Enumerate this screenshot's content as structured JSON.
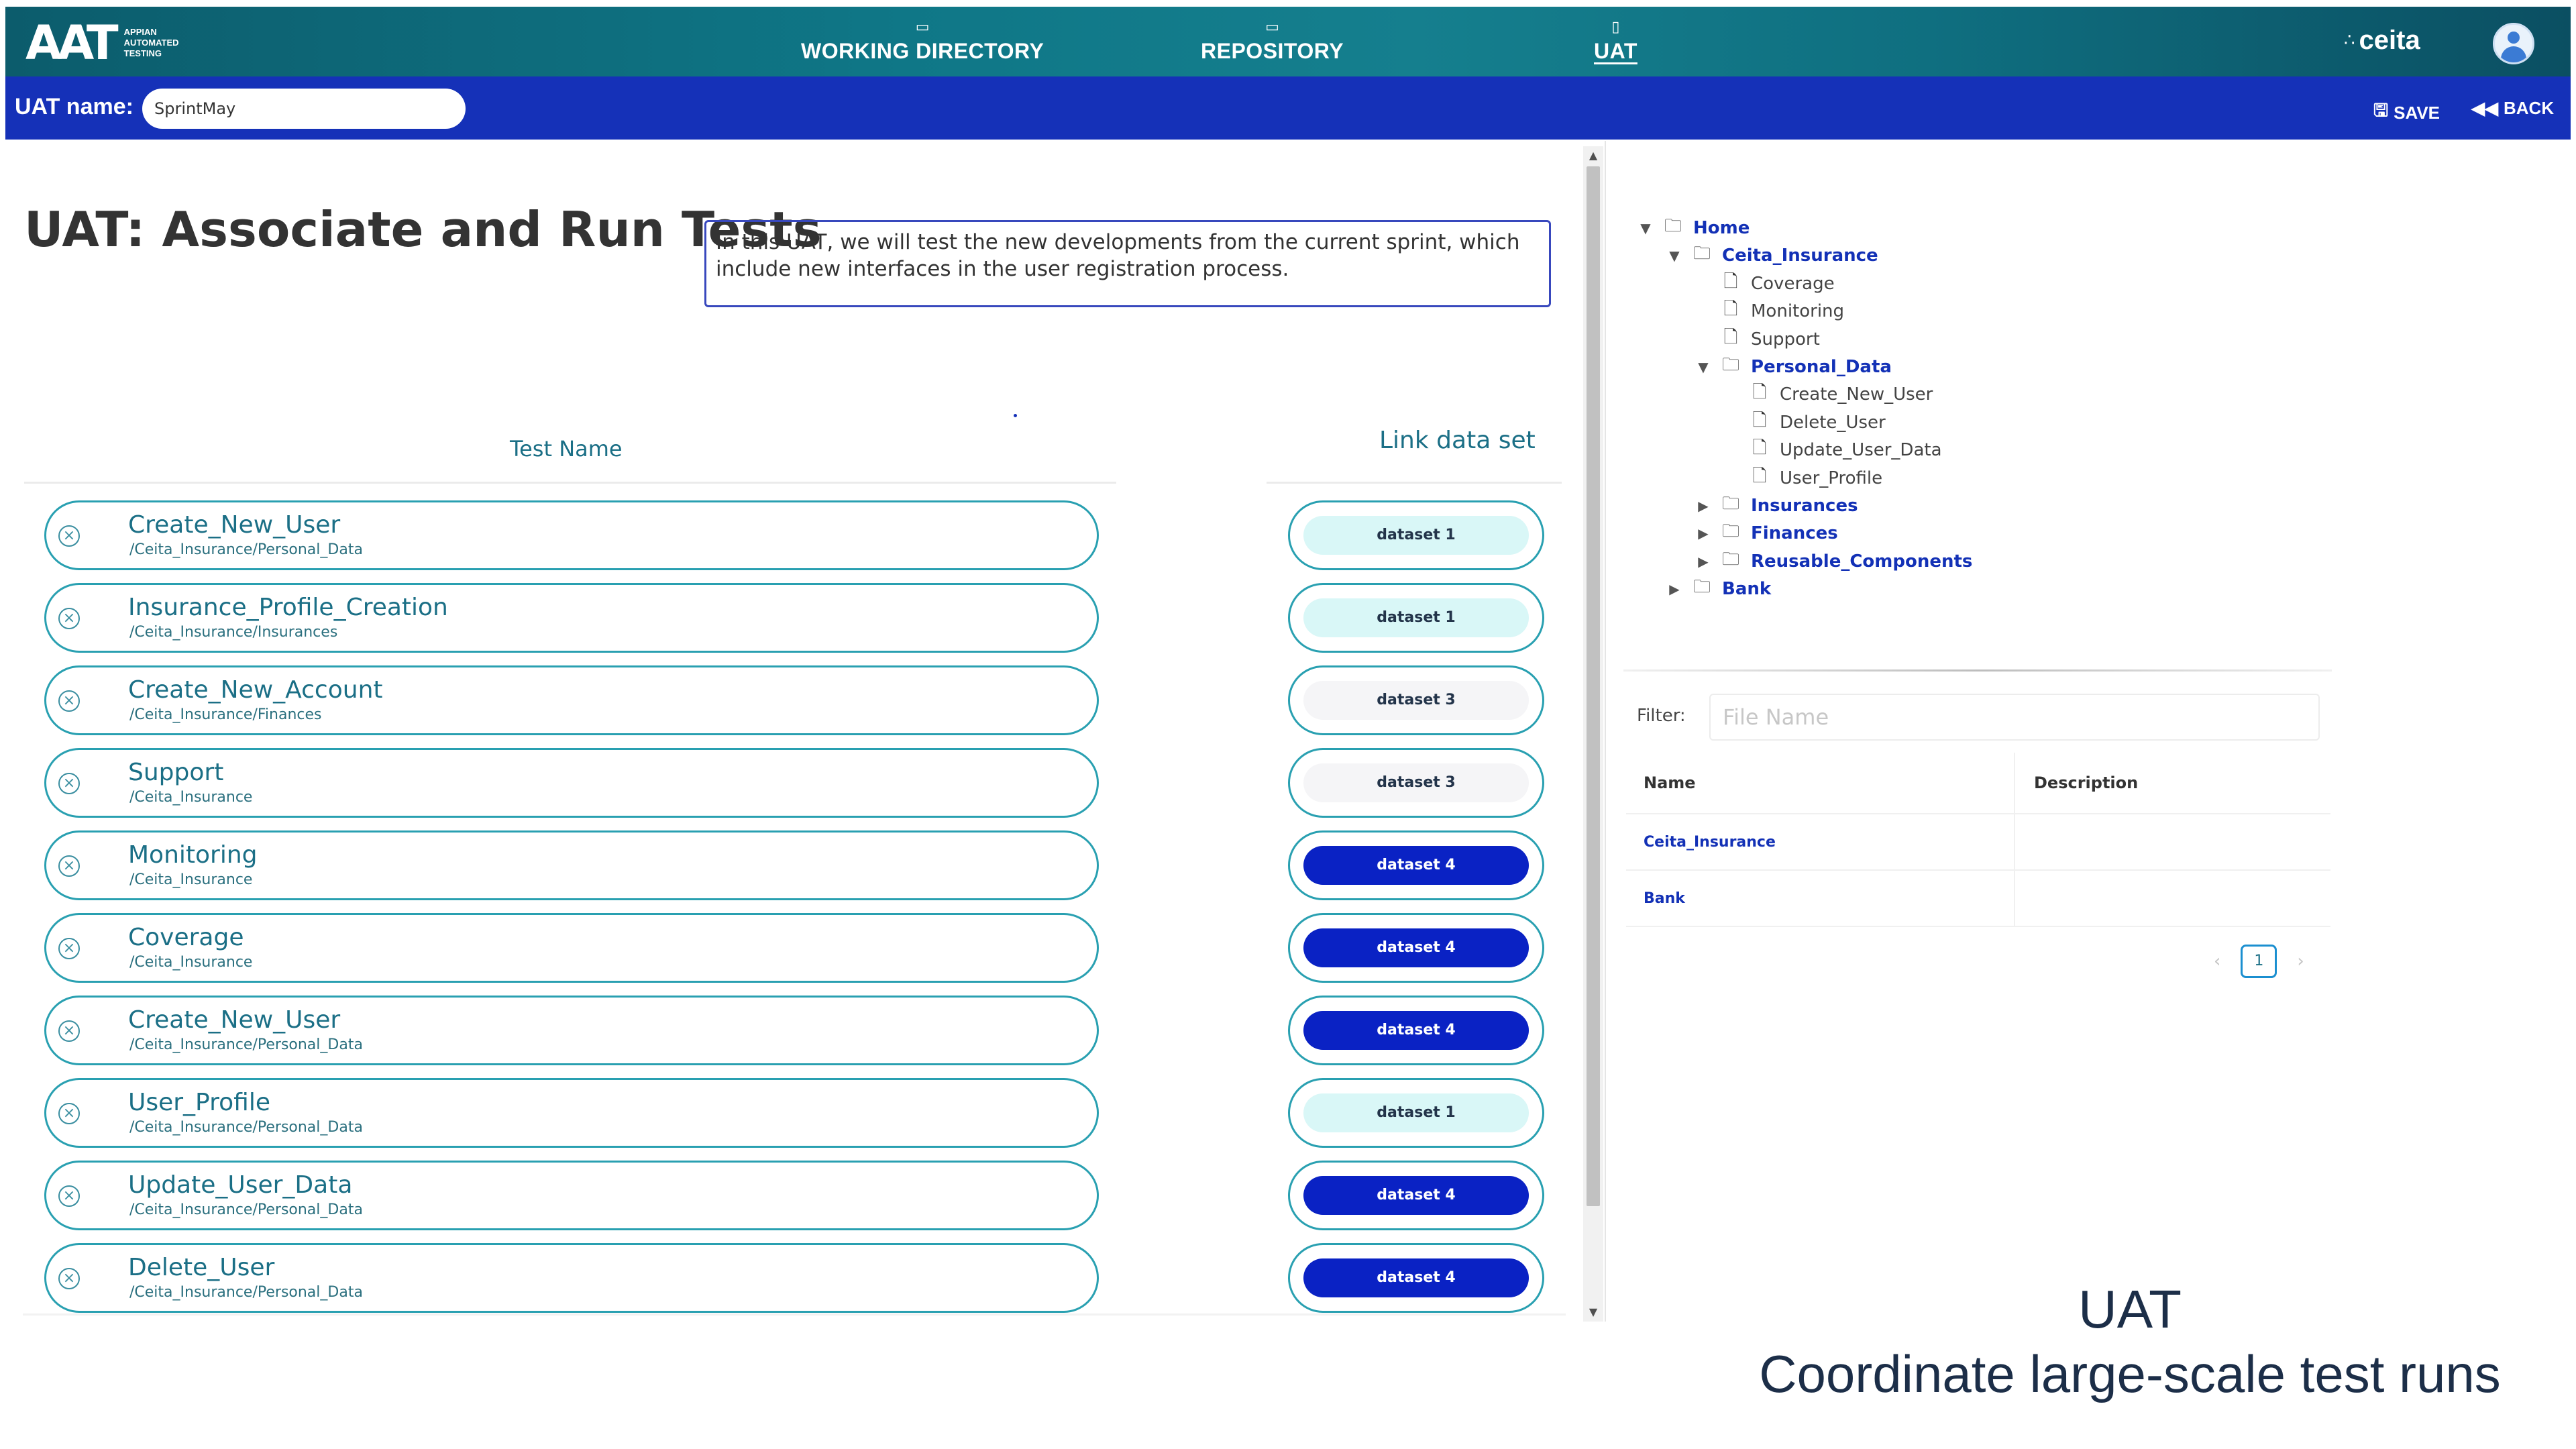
{
  "app": {
    "logo_text": "AAT",
    "logo_sub": [
      "APPIAN",
      "AUTOMATED",
      "TESTING"
    ],
    "brand": "ceita",
    "nav": [
      {
        "label": "WORKING DIRECTORY",
        "icon": "folder-icon"
      },
      {
        "label": "REPOSITORY",
        "icon": "archive-icon"
      },
      {
        "label": "UAT",
        "icon": "document-icon",
        "active": true
      }
    ],
    "accent_color": "#1531b8",
    "header_gradient": "#0f7787"
  },
  "uat_bar": {
    "name_label": "UAT name:",
    "name_value": "SprintMay",
    "save_label": "SAVE",
    "back_label": "BACK"
  },
  "main": {
    "title": "UAT: Associate and Run Tests",
    "description": "In this UAT, we will test the new developments from the current sprint, which include new interfaces in the user registration process.",
    "col_test_name": "Test Name",
    "col_link_dataset": "Link data set",
    "tests": [
      {
        "name": "Create_New_User",
        "path": "/Ceita_Insurance/Personal_Data",
        "dataset": "dataset 1",
        "style": "light"
      },
      {
        "name": "Insurance_Profile_Creation",
        "path": "/Ceita_Insurance/Insurances",
        "dataset": "dataset 1",
        "style": "light"
      },
      {
        "name": "Create_New_Account",
        "path": "/Ceita_Insurance/Finances",
        "dataset": "dataset 3",
        "style": "gray"
      },
      {
        "name": "Support",
        "path": "/Ceita_Insurance",
        "dataset": "dataset 3",
        "style": "gray"
      },
      {
        "name": "Monitoring",
        "path": "/Ceita_Insurance",
        "dataset": "dataset 4",
        "style": "dark"
      },
      {
        "name": "Coverage",
        "path": "/Ceita_Insurance",
        "dataset": "dataset 4",
        "style": "dark"
      },
      {
        "name": "Create_New_User",
        "path": "/Ceita_Insurance/Personal_Data",
        "dataset": "dataset 4",
        "style": "dark"
      },
      {
        "name": "User_Profile",
        "path": "/Ceita_Insurance/Personal_Data",
        "dataset": "dataset 1",
        "style": "light"
      },
      {
        "name": "Update_User_Data",
        "path": "/Ceita_Insurance/Personal_Data",
        "dataset": "dataset 4",
        "style": "dark"
      },
      {
        "name": "Delete_User",
        "path": "/Ceita_Insurance/Personal_Data",
        "dataset": "dataset 4",
        "style": "dark"
      }
    ]
  },
  "tree": {
    "nodes": [
      {
        "label": "Home",
        "type": "folder",
        "toggle": "expanded",
        "depth": 0
      },
      {
        "label": "Ceita_Insurance",
        "type": "folder",
        "toggle": "expanded",
        "depth": 1
      },
      {
        "label": "Coverage",
        "type": "file",
        "depth": 2
      },
      {
        "label": "Monitoring",
        "type": "file",
        "depth": 2
      },
      {
        "label": "Support",
        "type": "file",
        "depth": 2
      },
      {
        "label": "Personal_Data",
        "type": "folder",
        "toggle": "expanded",
        "depth": 2
      },
      {
        "label": "Create_New_User",
        "type": "file",
        "depth": 3
      },
      {
        "label": "Delete_User",
        "type": "file",
        "depth": 3
      },
      {
        "label": "Update_User_Data",
        "type": "file",
        "depth": 3
      },
      {
        "label": "User_Profile",
        "type": "file",
        "depth": 3
      },
      {
        "label": "Insurances",
        "type": "folder",
        "toggle": "collapsed",
        "depth": 2
      },
      {
        "label": "Finances",
        "type": "folder",
        "toggle": "collapsed",
        "depth": 2
      },
      {
        "label": "Reusable_Components",
        "type": "folder",
        "toggle": "collapsed",
        "depth": 2
      },
      {
        "label": "Bank",
        "type": "folder",
        "toggle": "collapsed",
        "depth": 1
      }
    ]
  },
  "filter": {
    "label": "Filter:",
    "placeholder": "File Name",
    "columns": [
      "Name",
      "Description"
    ],
    "rows": [
      {
        "name": "Ceita_Insurance",
        "description": ""
      },
      {
        "name": "Bank",
        "description": ""
      }
    ],
    "current_page": "1"
  },
  "caption": {
    "line1": "UAT",
    "line2": "Coordinate large-scale test runs"
  }
}
